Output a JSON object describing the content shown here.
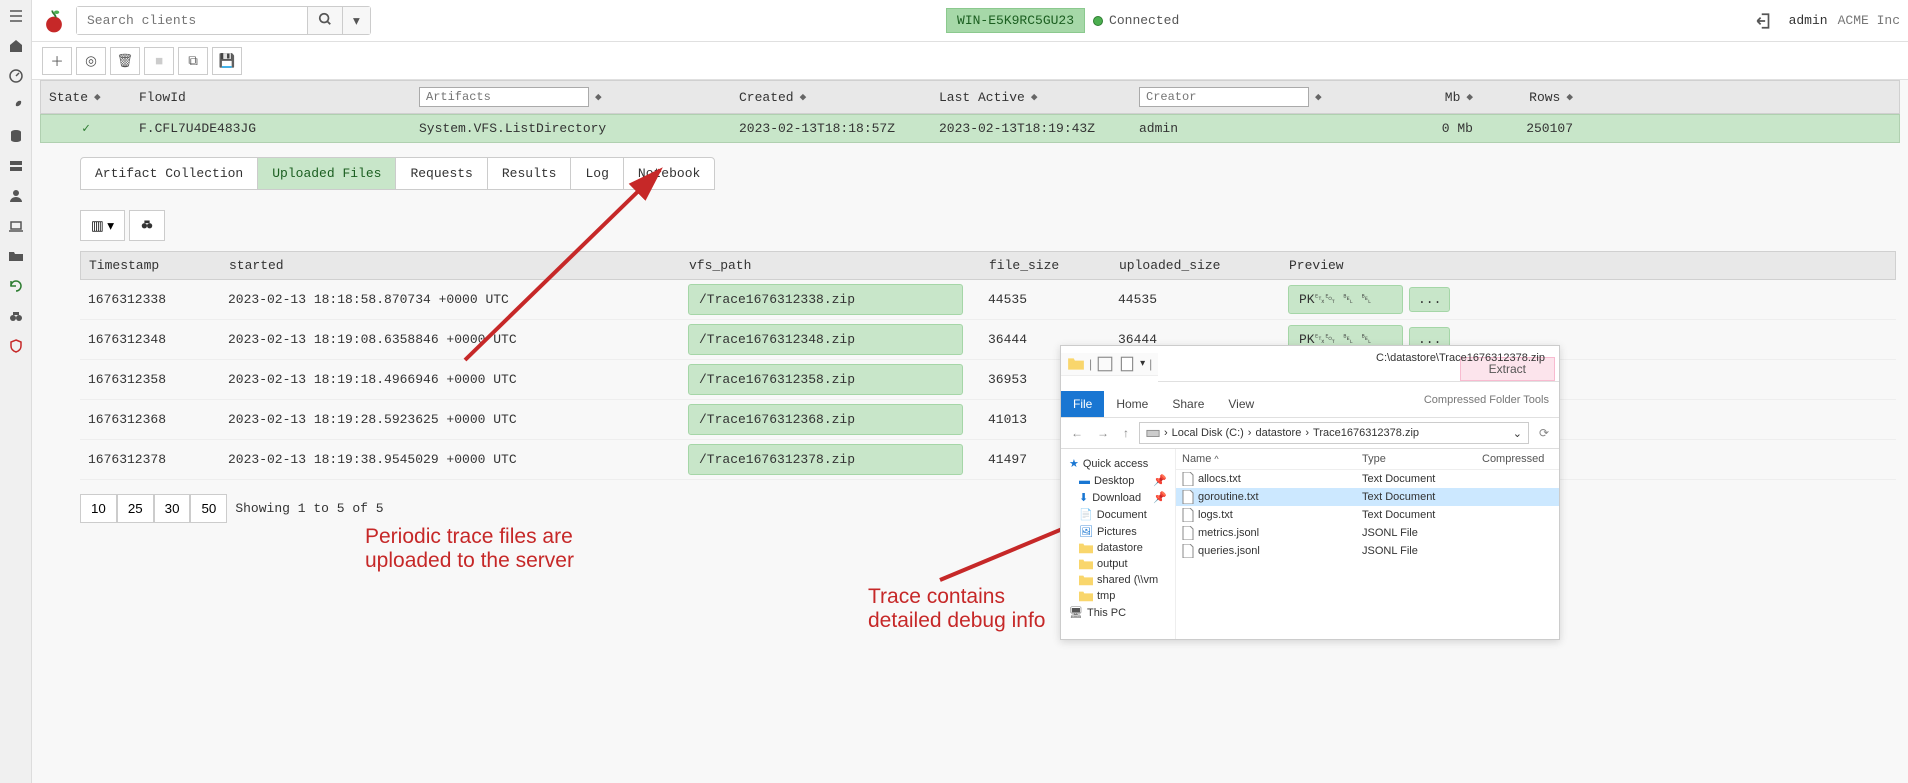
{
  "topbar": {
    "search_placeholder": "Search clients",
    "host_badge": "WIN-E5K9RC5GU23",
    "conn_label": "Connected",
    "user": "admin",
    "org": "ACME Inc"
  },
  "collections": {
    "headers": {
      "state": "State",
      "flowid": "FlowId",
      "artifacts_placeholder": "Artifacts",
      "created": "Created",
      "last_active": "Last Active",
      "creator_placeholder": "Creator",
      "mb": "Mb",
      "rows": "Rows"
    },
    "rows": [
      {
        "flowid": "F.CFL7U4DE483JG",
        "artifacts": "System.VFS.ListDirectory",
        "created": "2023-02-13T18:18:57Z",
        "last_active": "2023-02-13T18:19:43Z",
        "creator": "admin",
        "mb": "0 Mb",
        "rowcount": "250107"
      }
    ]
  },
  "tabs": {
    "artifact": "Artifact Collection",
    "uploaded": "Uploaded Files",
    "requests": "Requests",
    "results": "Results",
    "log": "Log",
    "notebook": "Notebook"
  },
  "uploads": {
    "headers": {
      "timestamp": "Timestamp",
      "started": "started",
      "vfs_path": "vfs_path",
      "file_size": "file_size",
      "uploaded_size": "uploaded_size",
      "preview": "Preview"
    },
    "rows": [
      {
        "ts": "1676312338",
        "started": "2023-02-13 18:18:58.870734 +0000 UTC",
        "vfs": "/Trace1676312338.zip",
        "fs": "44535",
        "us": "44535",
        "preview": "PK␃␄ ␇ ␇"
      },
      {
        "ts": "1676312348",
        "started": "2023-02-13 18:19:08.6358846 +0000 UTC",
        "vfs": "/Trace1676312348.zip",
        "fs": "36444",
        "us": "36444",
        "preview": "PK␃␄ ␇ ␇"
      },
      {
        "ts": "1676312358",
        "started": "2023-02-13 18:19:18.4966946 +0000 UTC",
        "vfs": "/Trace1676312358.zip",
        "fs": "36953",
        "us": "",
        "preview": ""
      },
      {
        "ts": "1676312368",
        "started": "2023-02-13 18:19:28.5923625 +0000 UTC",
        "vfs": "/Trace1676312368.zip",
        "fs": "41013",
        "us": "",
        "preview": ""
      },
      {
        "ts": "1676312378",
        "started": "2023-02-13 18:19:38.9545029 +0000 UTC",
        "vfs": "/Trace1676312378.zip",
        "fs": "41497",
        "us": "",
        "preview": ""
      }
    ],
    "page_sizes": [
      "10",
      "25",
      "30",
      "50"
    ],
    "pager_info": "Showing 1 to 5 of 5"
  },
  "annotations": {
    "a1_line1": "Periodic trace files are",
    "a1_line2": "uploaded to the server",
    "a2_line1": "Trace contains",
    "a2_line2": "detailed debug info"
  },
  "explorer": {
    "title_path": "C:\\datastore\\Trace1676312378.zip",
    "context_label": "Compressed Folder Tools",
    "extract_label": "Extract",
    "tabs": {
      "file": "File",
      "home": "Home",
      "share": "Share",
      "view": "View"
    },
    "breadcrumbs": [
      "Local Disk (C:)",
      "datastore",
      "Trace1676312378.zip"
    ],
    "tree": {
      "quick": "Quick access",
      "desktop": "Desktop",
      "download": "Download",
      "documents": "Document",
      "pictures": "Pictures",
      "datastore": "datastore",
      "output": "output",
      "shared": "shared (\\\\vm",
      "tmp": "tmp",
      "thispc": "This PC"
    },
    "file_headers": {
      "name": "Name",
      "type": "Type",
      "compressed": "Compressed"
    },
    "files": [
      {
        "name": "allocs.txt",
        "type": "Text Document"
      },
      {
        "name": "goroutine.txt",
        "type": "Text Document"
      },
      {
        "name": "logs.txt",
        "type": "Text Document"
      },
      {
        "name": "metrics.jsonl",
        "type": "JSONL File"
      },
      {
        "name": "queries.jsonl",
        "type": "JSONL File"
      }
    ]
  }
}
